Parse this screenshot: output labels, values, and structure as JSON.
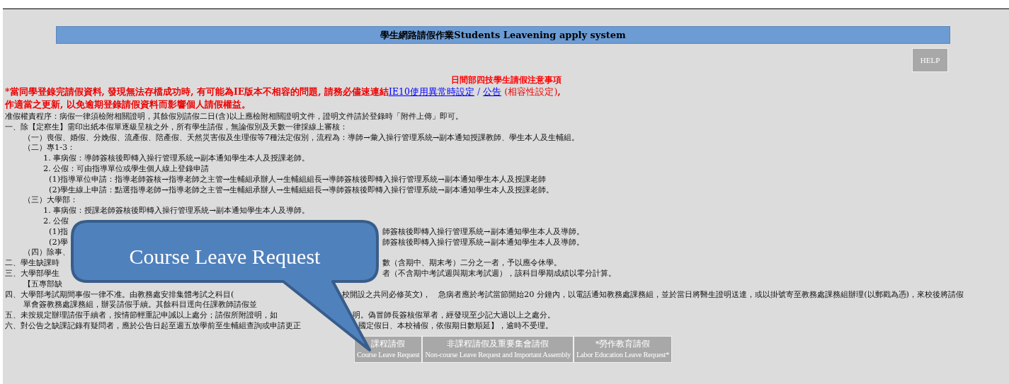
{
  "title": "學生網路請假作業Students Leavening apply system",
  "help_button": "HELP",
  "notice_heading": "日間部四技學生請假注意事項",
  "warning": [
    [
      {
        "kind": "bold",
        "text": "*當同學登錄完請假資料, 發現無法存檔成功時, 有可能為IE版本不相容的問題, 請務必儘速連結"
      },
      {
        "kind": "link",
        "text": "IE10使用異常時設定"
      },
      {
        "kind": "sep",
        "text": " / "
      },
      {
        "kind": "link",
        "text": "公告"
      },
      {
        "kind": "note",
        "text": " (相容性設定)"
      },
      {
        "kind": "bold",
        "text": ","
      }
    ],
    [
      {
        "kind": "bold",
        "text": "作適當之更新, 以免逾期登錄請假資料而影響個人請假權益。"
      }
    ]
  ],
  "rules": [
    {
      "text": "准假權責程序：病假一律須檢附相關證明，其餘假別請假二日(含)以上應檢附相關證明文件，證明文件請於登錄時「附件上傳」即可。"
    },
    {
      "text": "一、除【定察生】需印出紙本假單逐級呈核之外，所有學生請假，無論假別及天數一律採線上審核：",
      "children": [
        {
          "text": "（一）喪假、婚假、分娩假、流產假、陪產假、天然災害假及生理假等7種法定假別，流程為：導師→彙入操行管理系統→副本通知授課教師、學生本人及生輔組。"
        },
        {
          "text": "（二）專1-3：",
          "children": [
            {
              "text": "1. 事病假：導師簽核後即轉入操行管理系統→副本通知學生本人及授課老師。"
            },
            {
              "text": "2. 公假：可由指導單位或學生個人線上登錄申請",
              "children": [
                {
                  "text": "(1)指導單位申請：指導老師簽核→指導老師之主管→生輔組承辦人→生輔組組長→導師簽核後即轉入操行管理系統→副本通知學生本人及授課老師"
                },
                {
                  "text": "(2)學生線上申請：點選指導老師→指導老師之主管→生輔組承辦人→生輔組組長→導師簽核後即轉入操行管理系統→副本通知學生本人及授課老師。"
                }
              ]
            }
          ]
        },
        {
          "text": "（三）大學部：",
          "children": [
            {
              "text": "1. 事病假：授課老師簽核後即轉入操行管理系統→副本通知學生本人及導師。"
            },
            {
              "text": "2. 公假",
              "children": [
                {
                  "text": "(1)指",
                  "tail": "師簽核後即轉入操行管理系統→副本通知學生本人及導師。"
                },
                {
                  "text": "(2)學",
                  "tail": "師簽核後即轉入操行管理系統→副本通知學生本人及導師。"
                }
              ]
            }
          ]
        },
        {
          "text": "（四）除事、"
        }
      ]
    },
    {
      "text": "二、學生缺課時",
      "tail": "數（含期中、期末考）二分之一者，予以應令休學。"
    },
    {
      "text": "三、大學部學生",
      "tail": "者（不含期中考試週與期末考試週），該科目學期成績以零分計算。",
      "children": [
        {
          "text": "【五專部缺"
        }
      ]
    },
    {
      "text": "四、大學部考試期間事假一律不准。由教務處安排集體考試之科目(",
      "tail": "校開設之共同必修英文)，　急病者應於考試當節開始20 分鐘內，以電話通知教務處課務組，並於當日將醫生證明送達，或以掛號寄至教務處課務組辦理(以郵戳為憑)，來校後將請假",
      "children": [
        {
          "text": "單會簽教務處課務組，辦妥請假手續。其餘科目逕向任課教師請假並"
        }
      ]
    },
    {
      "text": "五、未按規定辦理請假手續者，按情節輕重記申誡以上處分；請假所附證明，如",
      "tail": "明。偽冒師長簽核假單者，經發現至少記大過以上之處分。"
    },
    {
      "text": "六、對公告之缺課記錄有疑問者，應於公告日起至週五放學前至生輔組查詢或申請更正",
      "tail": "國定假日、本校補假，依假期日數順延】，逾時不受理。"
    }
  ],
  "leave_buttons": [
    {
      "label": "課程請假",
      "sublabel": "Course Leave Request"
    },
    {
      "label": "非課程請假及重要集會請假",
      "sublabel": "Non-course Leave Request and Important Assembly"
    },
    {
      "label": "*勞作教育請假",
      "sublabel": "Labor Education Leave Request*"
    }
  ],
  "callout": {
    "text": "Course Leave Request"
  }
}
